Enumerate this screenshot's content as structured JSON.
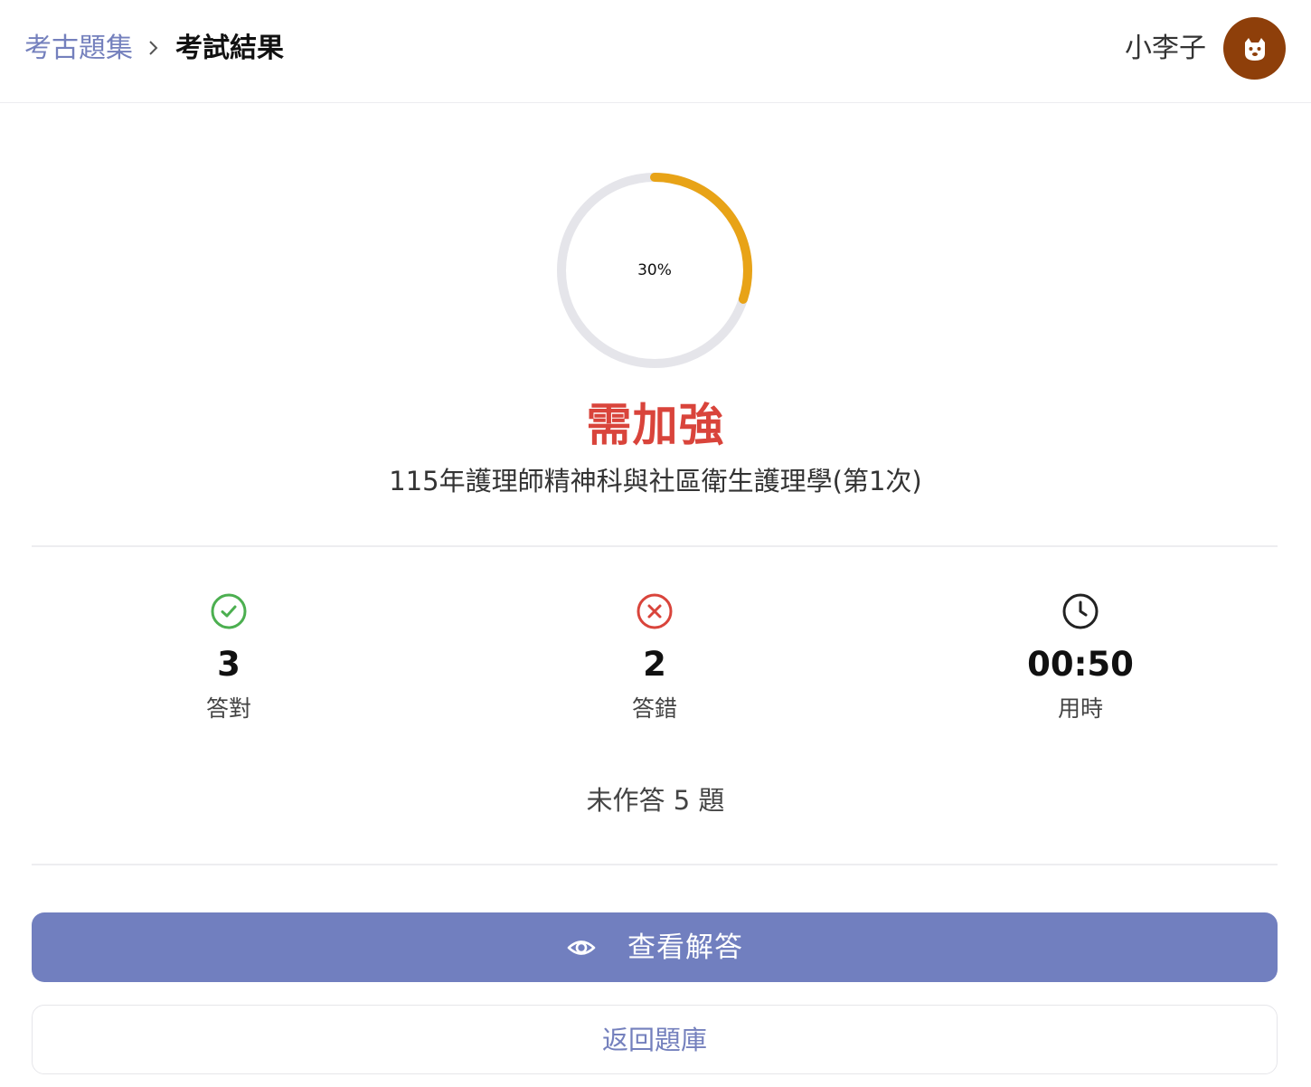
{
  "header": {
    "breadcrumb_link": "考古題集",
    "breadcrumb_current": "考試結果",
    "user_name": "小李子",
    "avatar_icon": "dog-face-icon",
    "link_color": "#7480bd",
    "avatar_color": "#8e3f0a"
  },
  "result": {
    "score_text": "30%",
    "score_fraction": 0.3,
    "gauge_color": "#e8a317",
    "verdict": "需加強",
    "verdict_color": "#d9443b",
    "exam_title": "115年護理師精神科與社區衛生護理學(第1次)"
  },
  "stats": [
    {
      "icon": "check-circle-icon",
      "color": "#4caf50",
      "value": "3",
      "label": "答對"
    },
    {
      "icon": "x-circle-icon",
      "color": "#d9443b",
      "value": "2",
      "label": "答錯"
    },
    {
      "icon": "clock-icon",
      "color": "#222222",
      "value": "00:50",
      "label": "用時"
    }
  ],
  "unanswered": "未作答 5 題",
  "actions": {
    "view_answers_label": "查看解答",
    "view_answers_icon": "eye-icon",
    "back_label": "返回題庫",
    "primary_color": "#717fbf"
  }
}
